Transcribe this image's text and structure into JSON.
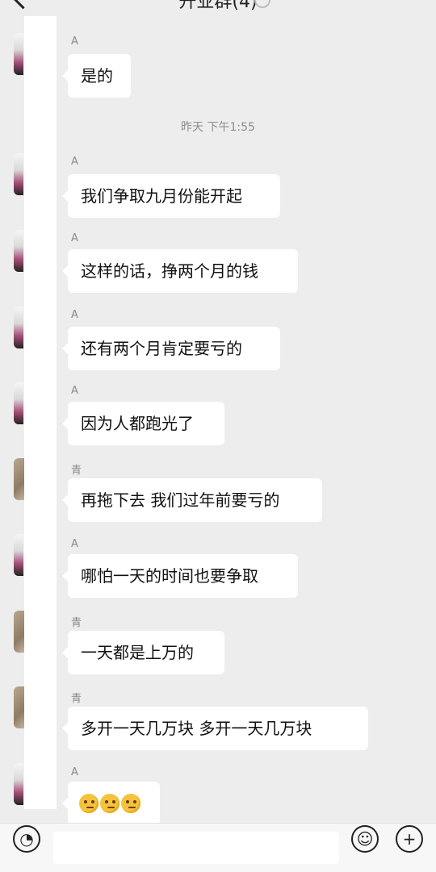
{
  "header": {
    "title": "开业群(4)"
  },
  "chat": {
    "timestamp": "昨天 下午1:55",
    "messages": [
      {
        "sender": "A",
        "text": "是的",
        "avatar": "avatar-a"
      },
      {
        "sender": "A",
        "text": "我们争取九月份能开起",
        "avatar": "avatar-a"
      },
      {
        "sender": "A",
        "text": "这样的话，挣两个月的钱",
        "avatar": "avatar-a"
      },
      {
        "sender": "A",
        "text": "还有两个月肯定要亏的",
        "avatar": "avatar-a"
      },
      {
        "sender": "A",
        "text": "因为人都跑光了",
        "avatar": "avatar-a"
      },
      {
        "sender": "青",
        "text": "再拖下去 我们过年前要亏的",
        "avatar": "avatar-q"
      },
      {
        "sender": "A",
        "text": "哪怕一天的时间也要争取",
        "avatar": "avatar-a"
      },
      {
        "sender": "青",
        "text": "一天都是上万的",
        "avatar": "avatar-q"
      },
      {
        "sender": "青",
        "text": "多开一天几万块 多开一天几万块",
        "avatar": "avatar-q"
      },
      {
        "sender": "A",
        "emoji": [
          "thinking-face-icon",
          "thinking-face-icon",
          "thinking-face-icon"
        ],
        "avatar": "avatar-a"
      }
    ]
  },
  "composer": {
    "voice_icon": "voice-icon",
    "emoji_icon": "emoji-icon",
    "plus_icon": "plus-icon",
    "input_value": ""
  }
}
